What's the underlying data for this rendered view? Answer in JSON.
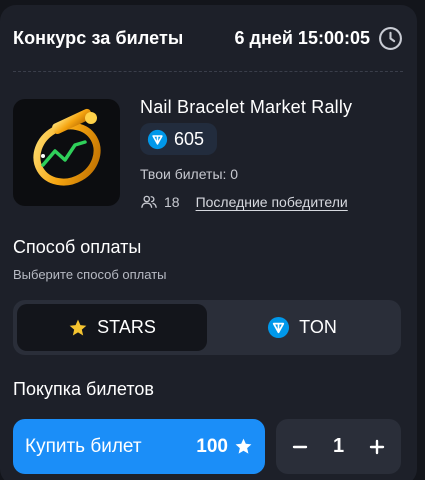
{
  "header": {
    "title": "Конкурс за билеты",
    "countdown": "6 дней 15:00:05"
  },
  "item": {
    "title": "Nail Bracelet Market Rally",
    "price": "605",
    "my_tickets": "Твои билеты: 0",
    "participants": "18",
    "winners_link": "Последние победители"
  },
  "payment": {
    "title": "Способ оплаты",
    "subtitle": "Выберите способ оплаты",
    "options": [
      "STARS",
      "TON"
    ],
    "selected": "STARS"
  },
  "purchase": {
    "title": "Покупка билетов",
    "buy_label": "Купить билет",
    "buy_price": "100",
    "quantity": "1"
  },
  "colors": {
    "background": "#13151b",
    "card": "#1d2029",
    "accent": "#1b8ef8",
    "ton": "#0098ea",
    "star": "#f5c430"
  }
}
